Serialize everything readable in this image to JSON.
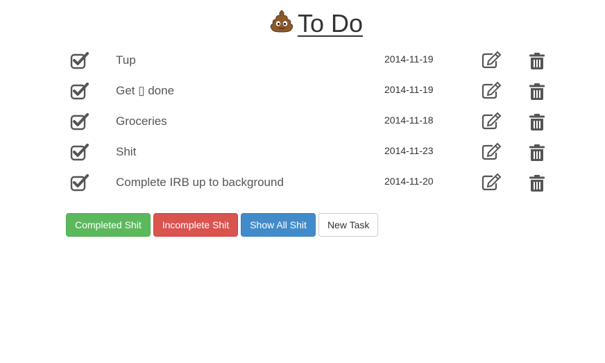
{
  "header": {
    "title": "To Do",
    "title_icon": "pile-of-poo-icon"
  },
  "tasks": [
    {
      "text": "Tup",
      "date": "2014-11-19",
      "completed": true
    },
    {
      "text": "Get ▯ done",
      "date": "2014-11-19",
      "completed": true
    },
    {
      "text": "Groceries",
      "date": "2014-11-18",
      "completed": true
    },
    {
      "text": "Shit",
      "date": "2014-11-23",
      "completed": true
    },
    {
      "text": "Complete IRB up to background",
      "date": "2014-11-20",
      "completed": true
    }
  ],
  "row_icons": {
    "check": "checkbox-checked-icon",
    "edit": "edit-icon",
    "delete": "trash-icon"
  },
  "toolbar": {
    "completed_label": "Completed Shit",
    "incomplete_label": "Incomplete Shit",
    "show_all_label": "Show All Shit",
    "new_task_label": "New Task"
  },
  "colors": {
    "success": "#5cb85c",
    "danger": "#d9534f",
    "primary": "#428bca",
    "icon": "#555555"
  }
}
